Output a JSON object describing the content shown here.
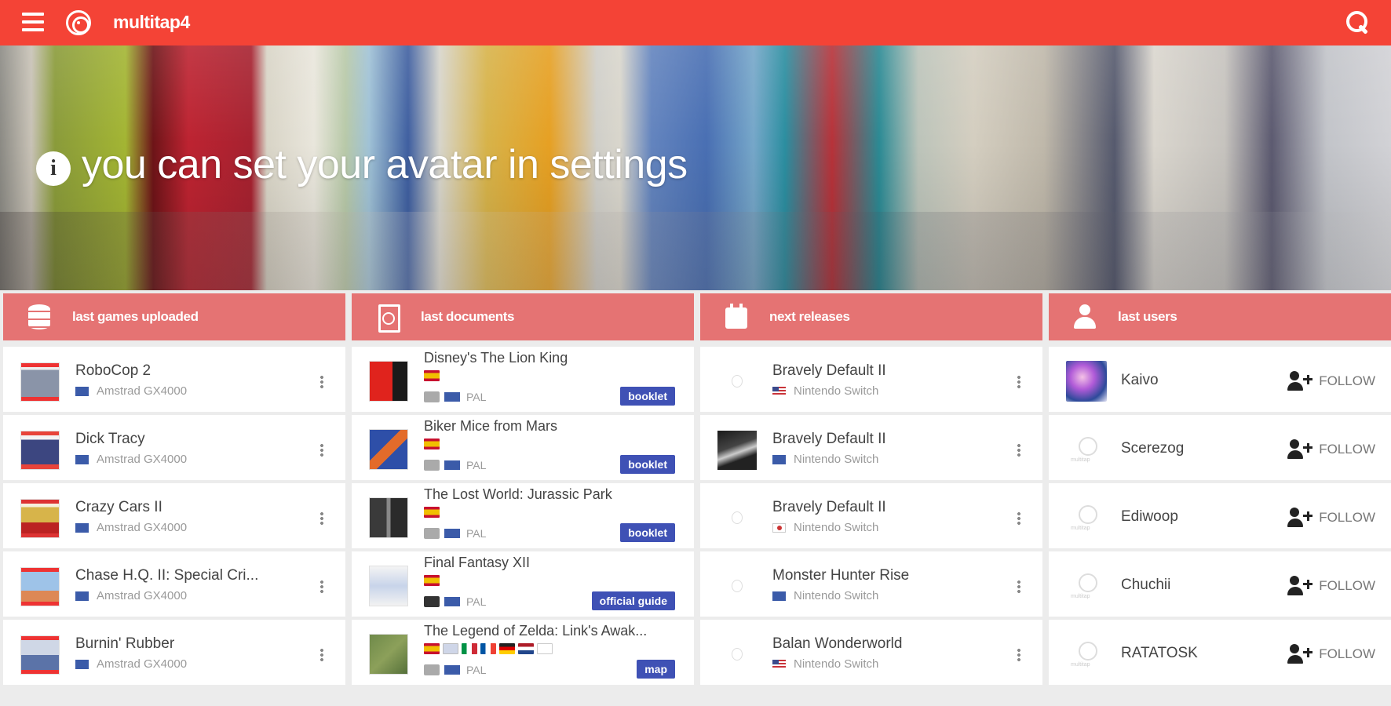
{
  "app": {
    "title": "multitap4"
  },
  "hero": {
    "message": "you can set your avatar in settings"
  },
  "columns": {
    "games": {
      "title": "last games uploaded",
      "items": [
        {
          "title": "RoboCop 2",
          "platform": "Amstrad GX4000"
        },
        {
          "title": "Dick Tracy",
          "platform": "Amstrad GX4000"
        },
        {
          "title": "Crazy Cars II",
          "platform": "Amstrad GX4000"
        },
        {
          "title": "Chase H.Q. II: Special Cri...",
          "platform": "Amstrad GX4000"
        },
        {
          "title": "Burnin' Rubber",
          "platform": "Amstrad GX4000"
        }
      ]
    },
    "documents": {
      "title": "last documents",
      "items": [
        {
          "title": "Disney's The Lion King",
          "region": "PAL",
          "tag": "booklet"
        },
        {
          "title": "Biker Mice from Mars",
          "region": "PAL",
          "tag": "booklet"
        },
        {
          "title": "The Lost World: Jurassic Park",
          "region": "PAL",
          "tag": "booklet"
        },
        {
          "title": "Final Fantasy XII",
          "region": "PAL",
          "tag": "official guide"
        },
        {
          "title": "The Legend of Zelda: Link's Awak...",
          "region": "PAL",
          "tag": "map"
        }
      ]
    },
    "releases": {
      "title": "next releases",
      "items": [
        {
          "title": "Bravely Default II",
          "platform": "Nintendo Switch"
        },
        {
          "title": "Bravely Default II",
          "platform": "Nintendo Switch"
        },
        {
          "title": "Bravely Default II",
          "platform": "Nintendo Switch"
        },
        {
          "title": "Monster Hunter Rise",
          "platform": "Nintendo Switch"
        },
        {
          "title": "Balan Wonderworld",
          "platform": "Nintendo Switch"
        }
      ]
    },
    "users": {
      "title": "last users",
      "follow_label": "FOLLOW",
      "items": [
        {
          "name": "Kaivo"
        },
        {
          "name": "Scerezog"
        },
        {
          "name": "Ediwoop"
        },
        {
          "name": "Chuchii"
        },
        {
          "name": "RATATOSK"
        }
      ]
    }
  },
  "icons": {
    "menu": "menu-icon",
    "logo": "multitap-logo-icon",
    "search": "search-icon",
    "info": "info-icon",
    "games": "database-icon",
    "documents": "pdf-document-icon",
    "releases": "calendar-icon",
    "users": "user-icon",
    "more": "more-vertical-icon",
    "follow": "person-add-icon"
  },
  "colors": {
    "topbar": "#f44336",
    "column_header": "#e57373",
    "tag": "#3f51b5"
  }
}
